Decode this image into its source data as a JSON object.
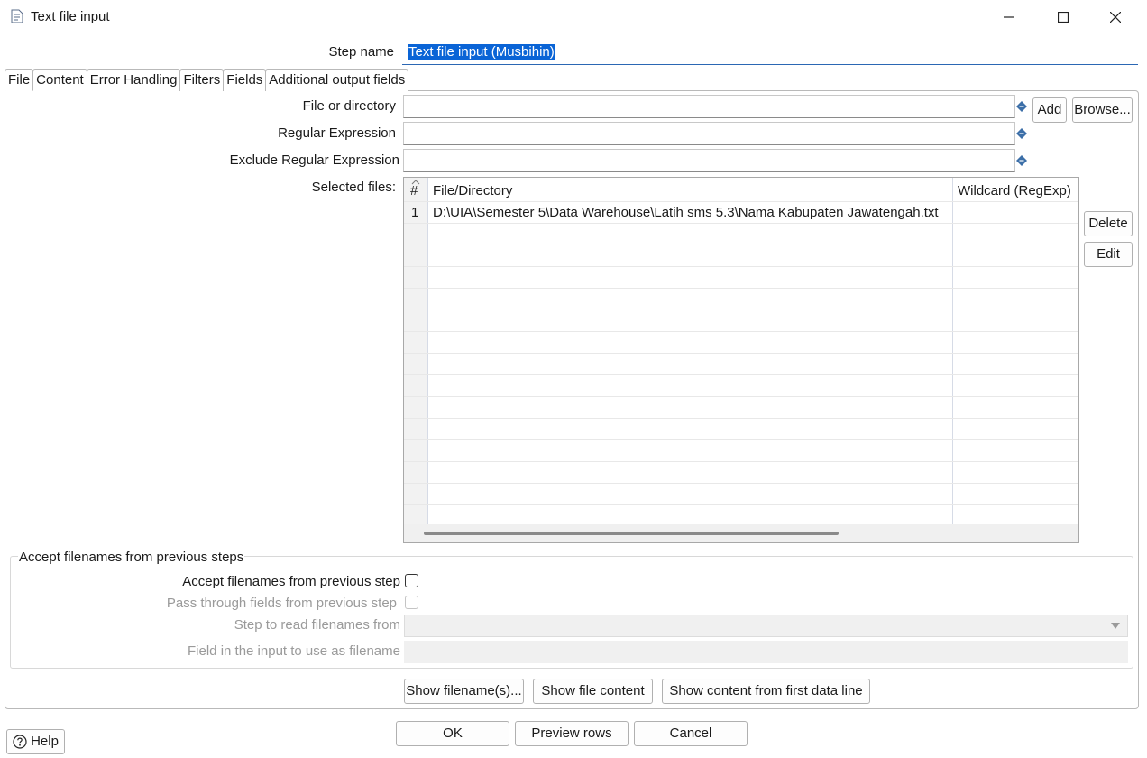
{
  "window": {
    "title": "Text file input"
  },
  "step_name": {
    "label": "Step name",
    "value": "Text file input (Musbihin)"
  },
  "tabs": [
    "File",
    "Content",
    "Error Handling",
    "Filters",
    "Fields",
    "Additional output fields"
  ],
  "file_tab": {
    "file_or_directory_label": "File or directory",
    "regex_label": "Regular Expression",
    "exclude_regex_label": "Exclude Regular Expression",
    "selected_files_label": "Selected files:",
    "add_button": "Add",
    "browse_button": "Browse...",
    "delete_button": "Delete",
    "edit_button": "Edit",
    "table": {
      "columns": [
        "#",
        "File/Directory",
        "Wildcard (RegExp)"
      ],
      "rows": [
        {
          "num": "1",
          "file": "D:\\UIA\\Semester 5\\Data Warehouse\\Latih sms 5.3\\Nama Kabupaten Jawatengah.txt",
          "wildcard": ""
        }
      ]
    },
    "accept_group": {
      "title": "Accept filenames from previous steps",
      "accept_label": "Accept filenames from previous step",
      "pass_through_label": "Pass through fields from previous step",
      "step_to_read_label": "Step to read filenames from",
      "field_label": "Field in the input to use as filename"
    },
    "show_filenames_button": "Show filename(s)...",
    "show_file_content_button": "Show file content",
    "show_content_first_line_button": "Show content from first data line"
  },
  "footer": {
    "help_button": "Help",
    "ok_button": "OK",
    "preview_button": "Preview rows",
    "cancel_button": "Cancel"
  }
}
